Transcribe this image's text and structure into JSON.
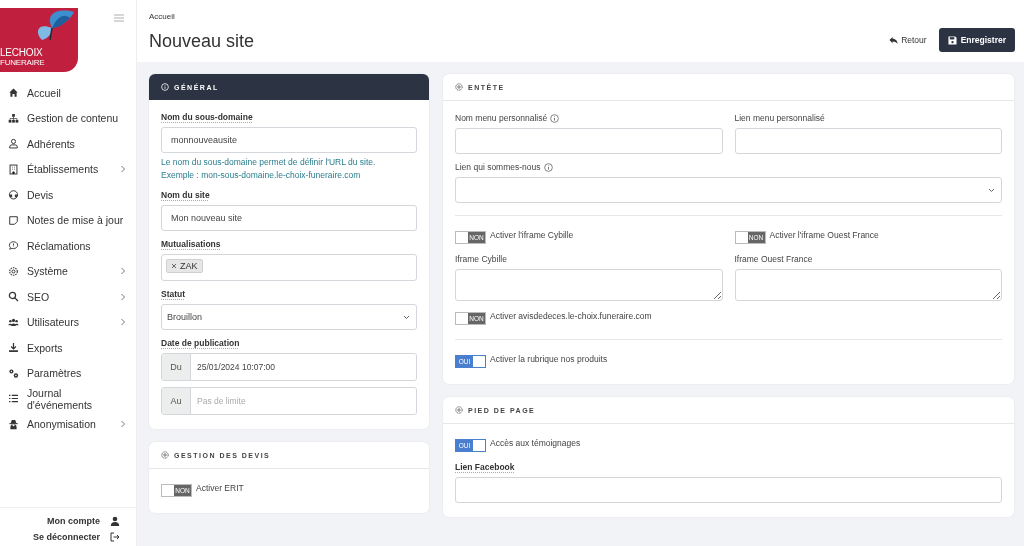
{
  "logo": {
    "line1": "LECHOIX",
    "line2": "FUNERAIRE"
  },
  "sidebar": {
    "items": [
      {
        "label": "Accueil",
        "expandable": false
      },
      {
        "label": "Gestion de contenu",
        "expandable": false
      },
      {
        "label": "Adhérents",
        "expandable": false
      },
      {
        "label": "Établissements",
        "expandable": true
      },
      {
        "label": "Devis",
        "expandable": false
      },
      {
        "label": "Notes de mise à jour",
        "expandable": false
      },
      {
        "label": "Réclamations",
        "expandable": false
      },
      {
        "label": "Système",
        "expandable": true
      },
      {
        "label": "SEO",
        "expandable": true
      },
      {
        "label": "Utilisateurs",
        "expandable": true
      },
      {
        "label": "Exports",
        "expandable": false
      },
      {
        "label": "Paramètres",
        "expandable": false
      },
      {
        "label": "Journal d'événements",
        "expandable": false
      },
      {
        "label": "Anonymisation",
        "expandable": true
      }
    ],
    "account": "Mon compte",
    "logout": "Se déconnecter"
  },
  "breadcrumb": "Accueil",
  "title": "Nouveau site",
  "actions": {
    "back": "Retour",
    "save": "Enregistrer"
  },
  "left_cards": [
    {
      "title": "GÉNÉRAL",
      "dark": true,
      "fields": [
        {
          "kind": "input",
          "label": "Nom du sous-domaine",
          "bold": true,
          "value": "monnouveausite",
          "help": [
            "Le nom du sous-domaine permet de définir l'URL du site.",
            "Exemple : mon-sous-domaine.le-choix-funeraire.com"
          ]
        },
        {
          "kind": "input",
          "label": "Nom du site",
          "bold": true,
          "value": "Mon nouveau site"
        },
        {
          "kind": "tags",
          "label": "Mutualisations",
          "bold": true,
          "tags": [
            "ZAK"
          ]
        },
        {
          "kind": "select",
          "label": "Statut",
          "bold": true,
          "value": "Brouillon"
        },
        {
          "kind": "dates",
          "label": "Date de publication",
          "bold": true,
          "rows": [
            {
              "prefix": "Du",
              "value": "25/01/2024 10:07:00"
            },
            {
              "prefix": "Au",
              "placeholder": "Pas de limite"
            }
          ]
        }
      ]
    },
    {
      "title": "GESTION DES DEVIS",
      "dark": false,
      "fields": [
        {
          "kind": "toggle",
          "label": "Activer ERIT",
          "on": false,
          "state_text": "NON"
        }
      ]
    }
  ],
  "right_cards": [
    {
      "title": "ENTÊTE",
      "dark": false,
      "fields": [
        {
          "kind": "row",
          "items": [
            {
              "kind": "input",
              "label": "Nom menu personnalisé",
              "bold": false,
              "info": true
            },
            {
              "kind": "input",
              "label": "Lien menu personnalisé",
              "bold": false,
              "info": false
            }
          ]
        },
        {
          "kind": "select",
          "label": "Lien qui sommes-nous",
          "bold": false,
          "info": true
        },
        {
          "kind": "divider"
        },
        {
          "kind": "row",
          "items": [
            {
              "kind": "toggle",
              "label": "Activer l'iframe Cybille",
              "on": false,
              "state_text": "NON"
            },
            {
              "kind": "toggle",
              "label": "Activer l'iframe Ouest France",
              "on": false,
              "state_text": "NON"
            }
          ]
        },
        {
          "kind": "row",
          "items": [
            {
              "kind": "textarea",
              "label": "Iframe Cybille",
              "bold": false
            },
            {
              "kind": "textarea",
              "label": "Iframe Ouest France",
              "bold": false
            }
          ]
        },
        {
          "kind": "toggle",
          "label": "Activer avisdedeces.le-choix.funeraire.com",
          "on": false,
          "state_text": "NON"
        },
        {
          "kind": "divider"
        },
        {
          "kind": "toggle",
          "label": "Activer la rubrique nos produits",
          "on": true,
          "state_text": "OUI"
        }
      ]
    },
    {
      "title": "PIED DE PAGE",
      "dark": false,
      "fields": [
        {
          "kind": "toggle",
          "label": "Accès aux témoignages",
          "on": true,
          "state_text": "OUI"
        },
        {
          "kind": "input",
          "label": "Lien Facebook",
          "bold": true
        }
      ]
    }
  ]
}
